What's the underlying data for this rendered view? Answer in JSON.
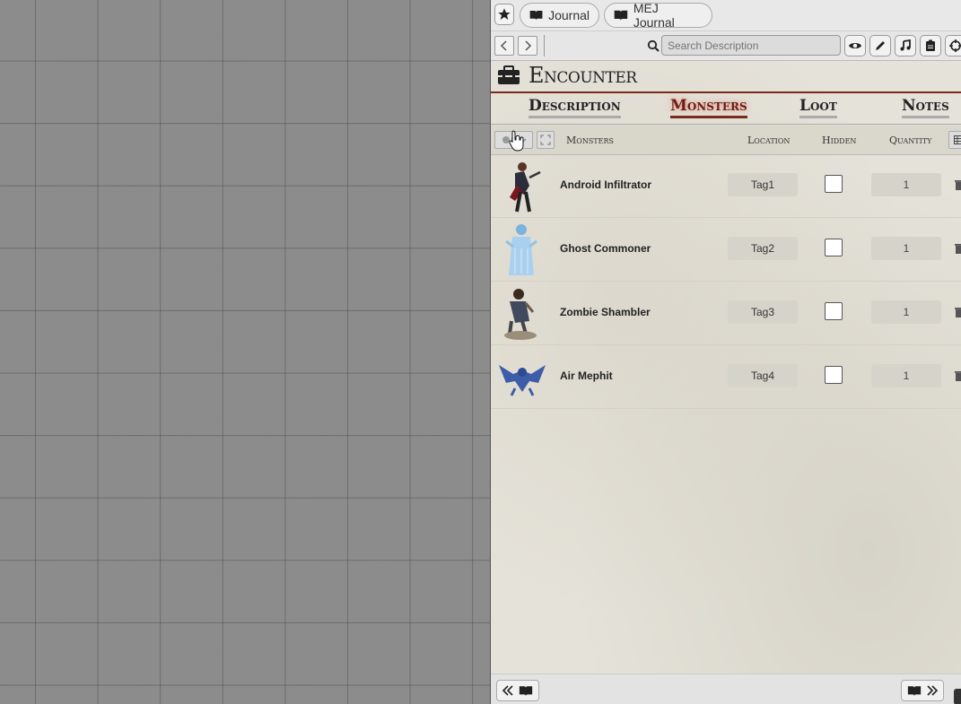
{
  "tabs": {
    "journal": "Journal",
    "mej": "MEJ Journal"
  },
  "search": {
    "placeholder": "Search Description"
  },
  "encounter": {
    "title": "Encounter"
  },
  "sections": [
    "Description",
    "Monsters",
    "Loot",
    "Notes"
  ],
  "active_section": "Monsters",
  "list_header": {
    "monsters": "Monsters",
    "location": "Location",
    "hidden": "Hidden",
    "quantity": "Quantity"
  },
  "monsters": [
    {
      "name": "Android Infiltrator",
      "location": "Tag1",
      "hidden": false,
      "quantity": "1"
    },
    {
      "name": "Ghost Commoner",
      "location": "Tag2",
      "hidden": false,
      "quantity": "1"
    },
    {
      "name": "Zombie Shambler",
      "location": "Tag3",
      "hidden": false,
      "quantity": "1"
    },
    {
      "name": "Air Mephit",
      "location": "Tag4",
      "hidden": false,
      "quantity": "1"
    }
  ],
  "colors": {
    "accent": "#7a2b1a",
    "canvas": "#8c8c8c",
    "parchment": "#e5e2d9"
  }
}
